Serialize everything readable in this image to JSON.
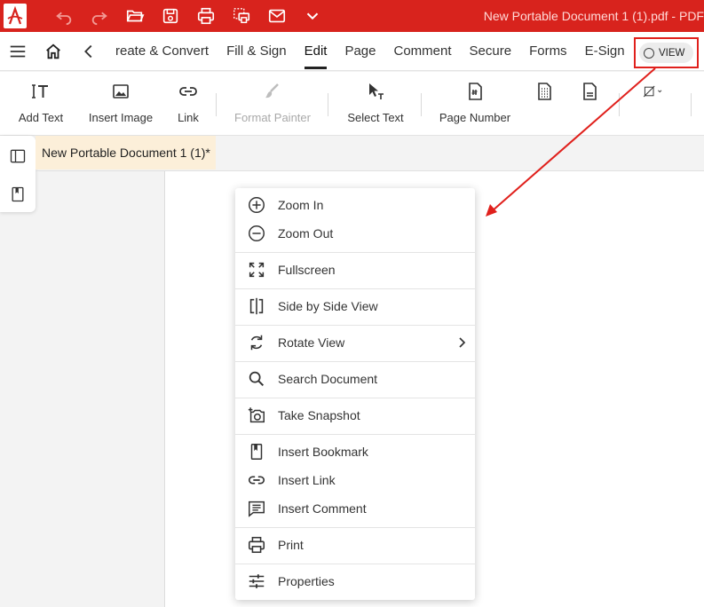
{
  "titlebar": {
    "doc_title": "New Portable Document 1 (1).pdf   -   PDF",
    "bg_color": "#d8231d"
  },
  "quick_toolbar": [
    "undo-icon",
    "redo-icon",
    "open-folder-icon",
    "save-icon",
    "print-icon",
    "batch-print-icon",
    "email-icon",
    "chevron-down-icon"
  ],
  "menubar": {
    "tabs": [
      {
        "label": "reate & Convert"
      },
      {
        "label": "Fill & Sign"
      },
      {
        "label": "Edit"
      },
      {
        "label": "Page"
      },
      {
        "label": "Comment"
      },
      {
        "label": "Secure"
      },
      {
        "label": "Forms"
      },
      {
        "label": "E-Sign"
      }
    ],
    "active_tab": "Edit",
    "view_label": "VIEW"
  },
  "ribbon": {
    "items": [
      {
        "label": "Add Text"
      },
      {
        "label": "Insert Image"
      },
      {
        "label": "Link"
      },
      {
        "label": "Format Painter",
        "disabled": true
      },
      {
        "label": "Select Text"
      },
      {
        "label": "Page Number"
      }
    ]
  },
  "doc_tab": {
    "label": "New Portable Document 1 (1)*",
    "bg_color": "#fcefd9"
  },
  "context_menu": {
    "items": [
      {
        "label": "Zoom In",
        "icon": "zoom-in-icon"
      },
      {
        "label": "Zoom Out",
        "icon": "zoom-out-icon"
      },
      {
        "label": "Fullscreen",
        "icon": "fullscreen-icon"
      },
      {
        "label": "Side by Side View",
        "icon": "side-by-side-icon"
      },
      {
        "label": "Rotate View",
        "icon": "rotate-icon",
        "has_submenu": true
      },
      {
        "label": "Search Document",
        "icon": "search-icon"
      },
      {
        "label": "Take Snapshot",
        "icon": "snapshot-icon"
      },
      {
        "label": "Insert Bookmark",
        "icon": "bookmark-icon"
      },
      {
        "label": "Insert Link",
        "icon": "link-icon"
      },
      {
        "label": "Insert Comment",
        "icon": "comment-icon"
      },
      {
        "label": "Print",
        "icon": "print-icon"
      },
      {
        "label": "Properties",
        "icon": "properties-icon"
      }
    ]
  },
  "annotation": {
    "color": "#e0201c"
  }
}
